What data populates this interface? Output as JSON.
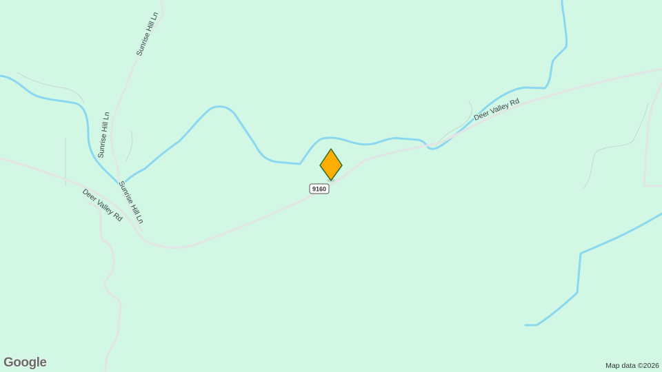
{
  "map": {
    "colors": {
      "land": "#d2f7e4",
      "water": "#8ad8ef",
      "road": "#e2e4e6",
      "marker_fill": "#ffad00",
      "marker_stroke": "#2e6b2a"
    },
    "roads": [
      {
        "name": "Deer Valley Rd",
        "label": "Deer Valley Rd"
      },
      {
        "name": "Deer Valley Rd",
        "label": "Deer Valley Rd"
      },
      {
        "name": "Sunrise Hill Ln",
        "label": "Sunrise Hill Ln"
      },
      {
        "name": "Sunrise Hill Ln",
        "label": "Sunrise Hill Ln"
      },
      {
        "name": "Sunrise Hill Ln",
        "label": "Sunrise Hill Ln"
      }
    ],
    "route_shield": "9160",
    "marker_icon": "map-pin-icon",
    "logo": "Google",
    "attribution": "Map data ©2026"
  }
}
